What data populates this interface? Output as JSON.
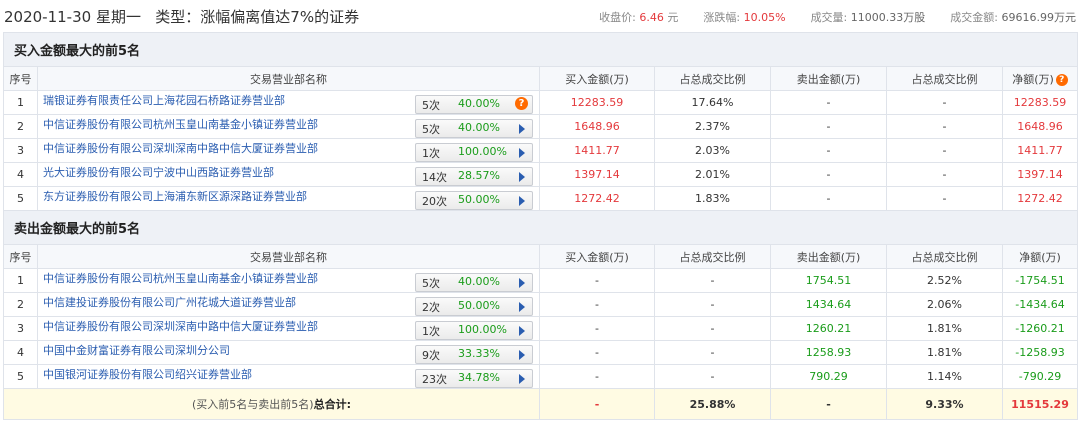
{
  "header": {
    "date": "2020-11-30 星期一",
    "type_label": "类型：",
    "type_value": "涨幅偏离值达7%的证券",
    "close_label": "收盘价:",
    "close_value": "6.46",
    "close_unit": "元",
    "change_label": "涨跌幅:",
    "change_value": "10.05%",
    "volume_label": "成交量:",
    "volume_value": "11000.33万股",
    "amount_label": "成交金额:",
    "amount_value": "69616.99万元"
  },
  "buy_section": {
    "title": "买入金额最大的前5名",
    "columns": [
      "序号",
      "交易营业部名称",
      "买入金额(万)",
      "占总成交比例",
      "卖出金额(万)",
      "占总成交比例",
      "净额(万)"
    ],
    "rows": [
      {
        "idx": "1",
        "name": "瑞银证券有限责任公司上海花园石桥路证券营业部",
        "count": "5次",
        "pct": "40.00%",
        "buy": "12283.59",
        "buy_ratio": "17.64%",
        "sell": "-",
        "sell_ratio": "-",
        "net": "12283.59",
        "q": "?"
      },
      {
        "idx": "2",
        "name": "中信证券股份有限公司杭州玉皇山南基金小镇证券营业部",
        "count": "5次",
        "pct": "40.00%",
        "buy": "1648.96",
        "buy_ratio": "2.37%",
        "sell": "-",
        "sell_ratio": "-",
        "net": "1648.96"
      },
      {
        "idx": "3",
        "name": "中信证券股份有限公司深圳深南中路中信大厦证券营业部",
        "count": "1次",
        "pct": "100.00%",
        "buy": "1411.77",
        "buy_ratio": "2.03%",
        "sell": "-",
        "sell_ratio": "-",
        "net": "1411.77"
      },
      {
        "idx": "4",
        "name": "光大证券股份有限公司宁波中山西路证券营业部",
        "count": "14次",
        "pct": "28.57%",
        "buy": "1397.14",
        "buy_ratio": "2.01%",
        "sell": "-",
        "sell_ratio": "-",
        "net": "1397.14"
      },
      {
        "idx": "5",
        "name": "东方证券股份有限公司上海浦东新区源深路证券营业部",
        "count": "20次",
        "pct": "50.00%",
        "buy": "1272.42",
        "buy_ratio": "1.83%",
        "sell": "-",
        "sell_ratio": "-",
        "net": "1272.42"
      }
    ]
  },
  "sell_section": {
    "title": "卖出金额最大的前5名",
    "columns": [
      "序号",
      "交易营业部名称",
      "买入金额(万)",
      "占总成交比例",
      "卖出金额(万)",
      "占总成交比例",
      "净额(万)"
    ],
    "rows": [
      {
        "idx": "1",
        "name": "中信证券股份有限公司杭州玉皇山南基金小镇证券营业部",
        "count": "5次",
        "pct": "40.00%",
        "buy": "-",
        "buy_ratio": "-",
        "sell": "1754.51",
        "sell_ratio": "2.52%",
        "net": "-1754.51"
      },
      {
        "idx": "2",
        "name": "中信建投证券股份有限公司广州花城大道证券营业部",
        "count": "2次",
        "pct": "50.00%",
        "buy": "-",
        "buy_ratio": "-",
        "sell": "1434.64",
        "sell_ratio": "2.06%",
        "net": "-1434.64"
      },
      {
        "idx": "3",
        "name": "中信证券股份有限公司深圳深南中路中信大厦证券营业部",
        "count": "1次",
        "pct": "100.00%",
        "buy": "-",
        "buy_ratio": "-",
        "sell": "1260.21",
        "sell_ratio": "1.81%",
        "net": "-1260.21"
      },
      {
        "idx": "4",
        "name": "中国中金财富证券有限公司深圳分公司",
        "count": "9次",
        "pct": "33.33%",
        "buy": "-",
        "buy_ratio": "-",
        "sell": "1258.93",
        "sell_ratio": "1.81%",
        "net": "-1258.93"
      },
      {
        "idx": "5",
        "name": "中国银河证券股份有限公司绍兴证券营业部",
        "count": "23次",
        "pct": "34.78%",
        "buy": "-",
        "buy_ratio": "-",
        "sell": "790.29",
        "sell_ratio": "1.14%",
        "net": "-790.29"
      }
    ]
  },
  "total": {
    "label_prefix": "(买入前5名与卖出前5名)",
    "label_bold": "总合计:",
    "buy": "-",
    "buy_ratio": "25.88%",
    "sell": "-",
    "sell_ratio": "9.33%",
    "net": "11515.29"
  },
  "colors": {
    "red": "#e4393c",
    "green": "#1a9c1a",
    "link": "#2a5db0",
    "accent_orange": "#ff6a00"
  }
}
